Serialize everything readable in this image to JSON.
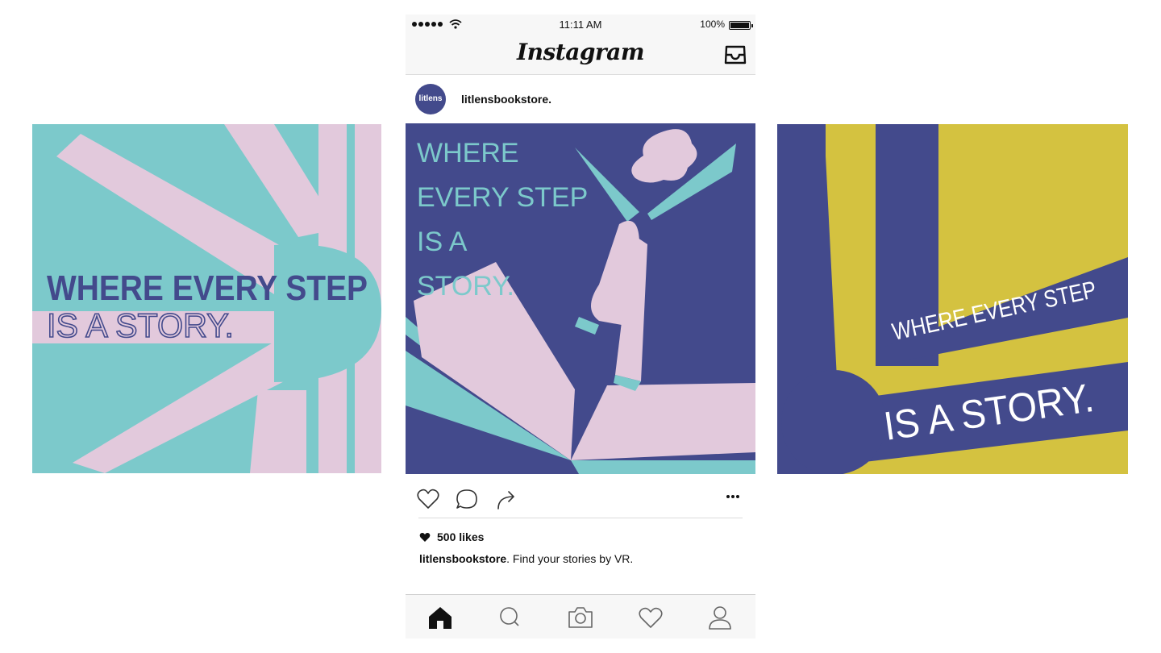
{
  "status_bar": {
    "time": "11:11 AM",
    "battery": "100%"
  },
  "header": {
    "app_name": "Instagram"
  },
  "post": {
    "avatar_text": "litlens",
    "username": "litlensbookstore.",
    "image_text": [
      "WHERE",
      "EVERY STEP",
      "IS A",
      "STORY."
    ],
    "likes": "500 likes",
    "caption_user": "litlensbookstore",
    "caption_text": ".  Find your stories by VR."
  },
  "left_post": {
    "line1": "WHERE EVERY STEP",
    "line2": "IS A STORY."
  },
  "right_post": {
    "line1": "WHERE EVERY STEP",
    "line2": "IS A STORY."
  },
  "colors": {
    "teal": "#7cc9cb",
    "pink": "#e2c9dc",
    "navy": "#434a8c",
    "mustard": "#d4c240"
  },
  "icons": [
    "wifi-icon",
    "inbox-icon",
    "heart-icon",
    "comment-icon",
    "share-icon",
    "more-icon",
    "home-icon",
    "search-icon",
    "camera-icon",
    "activity-icon",
    "profile-icon"
  ]
}
